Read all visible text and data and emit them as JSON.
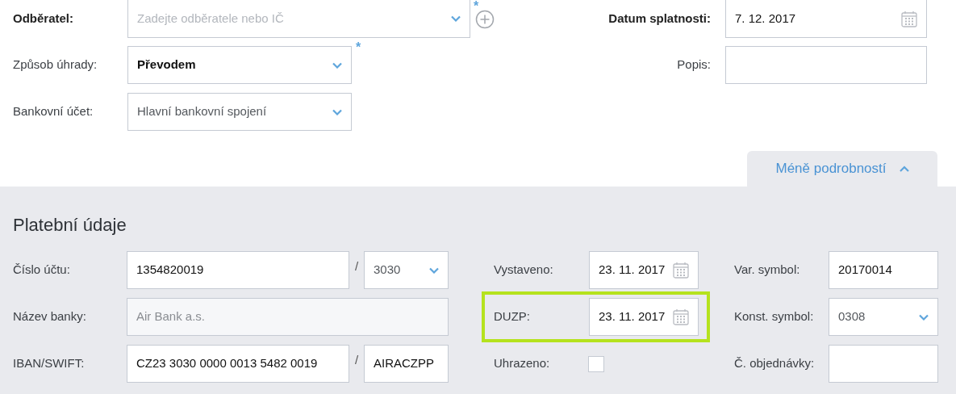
{
  "header_form": {
    "customer": {
      "label": "Odběratel:",
      "placeholder": "Zadejte odběratele nebo IČ",
      "required_mark": "*"
    },
    "payment_method": {
      "label": "Způsob úhrady:",
      "value": "Převodem",
      "required_mark": "*"
    },
    "bank_account": {
      "label": "Bankovní účet:",
      "value": "Hlavní bankovní spojení"
    },
    "due_date": {
      "label": "Datum splatnosti:",
      "value": "7. 12. 2017"
    },
    "description": {
      "label": "Popis:"
    }
  },
  "details_toggle": {
    "label": "Méně podrobností",
    "expanded": true
  },
  "payment_section": {
    "title": "Platební údaje",
    "account_number": {
      "label": "Číslo účtu:",
      "value": "1354820019",
      "separator": "/",
      "bank_code": "3030"
    },
    "bank_name": {
      "label": "Název banky:",
      "value": "Air Bank a.s.",
      "disabled": true
    },
    "iban": {
      "label": "IBAN/SWIFT:",
      "value": "CZ23 3030 0000 0013 5482 0019",
      "separator": "/",
      "swift": "AIRACZPP"
    },
    "issued": {
      "label": "Vystaveno:",
      "value": "23. 11. 2017"
    },
    "tax_date": {
      "label": "DUZP:",
      "value": "23. 11. 2017",
      "highlighted": true
    },
    "paid": {
      "label": "Uhrazeno:",
      "checked": false
    },
    "variable_symbol": {
      "label": "Var. symbol:",
      "value": "20170014"
    },
    "constant_symbol": {
      "label": "Konst. symbol:",
      "value": "0308"
    },
    "order_number": {
      "label": "Č. objednávky:"
    }
  }
}
